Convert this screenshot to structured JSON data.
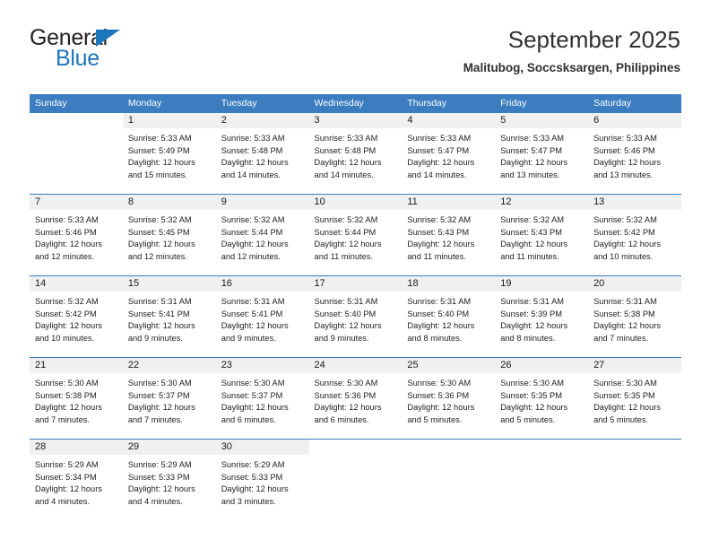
{
  "brand": {
    "name_part1": "General",
    "name_part2": "Blue",
    "logo_color": "#1c76bc"
  },
  "header": {
    "title": "September 2025",
    "subtitle": "Malitubog, Soccsksargen, Philippines",
    "header_bg_color": "#3b7dbf",
    "daynum_bg_color": "#f0f0f0"
  },
  "weekday_headers": [
    "Sunday",
    "Monday",
    "Tuesday",
    "Wednesday",
    "Thursday",
    "Friday",
    "Saturday"
  ],
  "labels": {
    "sunrise_prefix": "Sunrise:",
    "sunset_prefix": "Sunset:",
    "daylight_prefix": "Daylight:"
  },
  "weeks": [
    [
      {
        "day": "",
        "sunrise": "",
        "sunset": "",
        "daylight_line1": "",
        "daylight_line2": ""
      },
      {
        "day": "1",
        "sunrise": "Sunrise: 5:33 AM",
        "sunset": "Sunset: 5:49 PM",
        "daylight_line1": "Daylight: 12 hours",
        "daylight_line2": "and 15 minutes."
      },
      {
        "day": "2",
        "sunrise": "Sunrise: 5:33 AM",
        "sunset": "Sunset: 5:48 PM",
        "daylight_line1": "Daylight: 12 hours",
        "daylight_line2": "and 14 minutes."
      },
      {
        "day": "3",
        "sunrise": "Sunrise: 5:33 AM",
        "sunset": "Sunset: 5:48 PM",
        "daylight_line1": "Daylight: 12 hours",
        "daylight_line2": "and 14 minutes."
      },
      {
        "day": "4",
        "sunrise": "Sunrise: 5:33 AM",
        "sunset": "Sunset: 5:47 PM",
        "daylight_line1": "Daylight: 12 hours",
        "daylight_line2": "and 14 minutes."
      },
      {
        "day": "5",
        "sunrise": "Sunrise: 5:33 AM",
        "sunset": "Sunset: 5:47 PM",
        "daylight_line1": "Daylight: 12 hours",
        "daylight_line2": "and 13 minutes."
      },
      {
        "day": "6",
        "sunrise": "Sunrise: 5:33 AM",
        "sunset": "Sunset: 5:46 PM",
        "daylight_line1": "Daylight: 12 hours",
        "daylight_line2": "and 13 minutes."
      }
    ],
    [
      {
        "day": "7",
        "sunrise": "Sunrise: 5:33 AM",
        "sunset": "Sunset: 5:46 PM",
        "daylight_line1": "Daylight: 12 hours",
        "daylight_line2": "and 12 minutes."
      },
      {
        "day": "8",
        "sunrise": "Sunrise: 5:32 AM",
        "sunset": "Sunset: 5:45 PM",
        "daylight_line1": "Daylight: 12 hours",
        "daylight_line2": "and 12 minutes."
      },
      {
        "day": "9",
        "sunrise": "Sunrise: 5:32 AM",
        "sunset": "Sunset: 5:44 PM",
        "daylight_line1": "Daylight: 12 hours",
        "daylight_line2": "and 12 minutes."
      },
      {
        "day": "10",
        "sunrise": "Sunrise: 5:32 AM",
        "sunset": "Sunset: 5:44 PM",
        "daylight_line1": "Daylight: 12 hours",
        "daylight_line2": "and 11 minutes."
      },
      {
        "day": "11",
        "sunrise": "Sunrise: 5:32 AM",
        "sunset": "Sunset: 5:43 PM",
        "daylight_line1": "Daylight: 12 hours",
        "daylight_line2": "and 11 minutes."
      },
      {
        "day": "12",
        "sunrise": "Sunrise: 5:32 AM",
        "sunset": "Sunset: 5:43 PM",
        "daylight_line1": "Daylight: 12 hours",
        "daylight_line2": "and 11 minutes."
      },
      {
        "day": "13",
        "sunrise": "Sunrise: 5:32 AM",
        "sunset": "Sunset: 5:42 PM",
        "daylight_line1": "Daylight: 12 hours",
        "daylight_line2": "and 10 minutes."
      }
    ],
    [
      {
        "day": "14",
        "sunrise": "Sunrise: 5:32 AM",
        "sunset": "Sunset: 5:42 PM",
        "daylight_line1": "Daylight: 12 hours",
        "daylight_line2": "and 10 minutes."
      },
      {
        "day": "15",
        "sunrise": "Sunrise: 5:31 AM",
        "sunset": "Sunset: 5:41 PM",
        "daylight_line1": "Daylight: 12 hours",
        "daylight_line2": "and 9 minutes."
      },
      {
        "day": "16",
        "sunrise": "Sunrise: 5:31 AM",
        "sunset": "Sunset: 5:41 PM",
        "daylight_line1": "Daylight: 12 hours",
        "daylight_line2": "and 9 minutes."
      },
      {
        "day": "17",
        "sunrise": "Sunrise: 5:31 AM",
        "sunset": "Sunset: 5:40 PM",
        "daylight_line1": "Daylight: 12 hours",
        "daylight_line2": "and 9 minutes."
      },
      {
        "day": "18",
        "sunrise": "Sunrise: 5:31 AM",
        "sunset": "Sunset: 5:40 PM",
        "daylight_line1": "Daylight: 12 hours",
        "daylight_line2": "and 8 minutes."
      },
      {
        "day": "19",
        "sunrise": "Sunrise: 5:31 AM",
        "sunset": "Sunset: 5:39 PM",
        "daylight_line1": "Daylight: 12 hours",
        "daylight_line2": "and 8 minutes."
      },
      {
        "day": "20",
        "sunrise": "Sunrise: 5:31 AM",
        "sunset": "Sunset: 5:38 PM",
        "daylight_line1": "Daylight: 12 hours",
        "daylight_line2": "and 7 minutes."
      }
    ],
    [
      {
        "day": "21",
        "sunrise": "Sunrise: 5:30 AM",
        "sunset": "Sunset: 5:38 PM",
        "daylight_line1": "Daylight: 12 hours",
        "daylight_line2": "and 7 minutes."
      },
      {
        "day": "22",
        "sunrise": "Sunrise: 5:30 AM",
        "sunset": "Sunset: 5:37 PM",
        "daylight_line1": "Daylight: 12 hours",
        "daylight_line2": "and 7 minutes."
      },
      {
        "day": "23",
        "sunrise": "Sunrise: 5:30 AM",
        "sunset": "Sunset: 5:37 PM",
        "daylight_line1": "Daylight: 12 hours",
        "daylight_line2": "and 6 minutes."
      },
      {
        "day": "24",
        "sunrise": "Sunrise: 5:30 AM",
        "sunset": "Sunset: 5:36 PM",
        "daylight_line1": "Daylight: 12 hours",
        "daylight_line2": "and 6 minutes."
      },
      {
        "day": "25",
        "sunrise": "Sunrise: 5:30 AM",
        "sunset": "Sunset: 5:36 PM",
        "daylight_line1": "Daylight: 12 hours",
        "daylight_line2": "and 5 minutes."
      },
      {
        "day": "26",
        "sunrise": "Sunrise: 5:30 AM",
        "sunset": "Sunset: 5:35 PM",
        "daylight_line1": "Daylight: 12 hours",
        "daylight_line2": "and 5 minutes."
      },
      {
        "day": "27",
        "sunrise": "Sunrise: 5:30 AM",
        "sunset": "Sunset: 5:35 PM",
        "daylight_line1": "Daylight: 12 hours",
        "daylight_line2": "and 5 minutes."
      }
    ],
    [
      {
        "day": "28",
        "sunrise": "Sunrise: 5:29 AM",
        "sunset": "Sunset: 5:34 PM",
        "daylight_line1": "Daylight: 12 hours",
        "daylight_line2": "and 4 minutes."
      },
      {
        "day": "29",
        "sunrise": "Sunrise: 5:29 AM",
        "sunset": "Sunset: 5:33 PM",
        "daylight_line1": "Daylight: 12 hours",
        "daylight_line2": "and 4 minutes."
      },
      {
        "day": "30",
        "sunrise": "Sunrise: 5:29 AM",
        "sunset": "Sunset: 5:33 PM",
        "daylight_line1": "Daylight: 12 hours",
        "daylight_line2": "and 3 minutes."
      },
      {
        "day": "",
        "sunrise": "",
        "sunset": "",
        "daylight_line1": "",
        "daylight_line2": ""
      },
      {
        "day": "",
        "sunrise": "",
        "sunset": "",
        "daylight_line1": "",
        "daylight_line2": ""
      },
      {
        "day": "",
        "sunrise": "",
        "sunset": "",
        "daylight_line1": "",
        "daylight_line2": ""
      },
      {
        "day": "",
        "sunrise": "",
        "sunset": "",
        "daylight_line1": "",
        "daylight_line2": ""
      }
    ]
  ]
}
